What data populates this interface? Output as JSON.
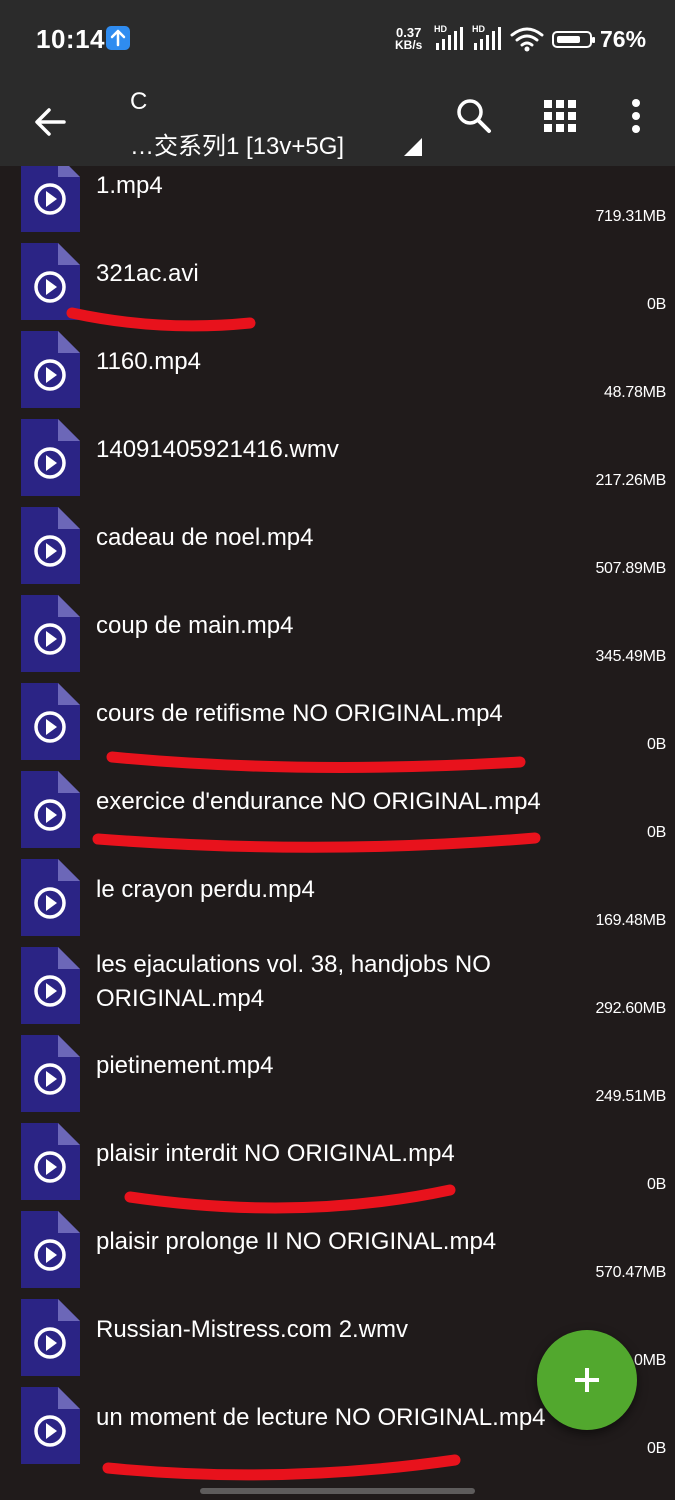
{
  "status_bar": {
    "time": "10:14",
    "net_speed_value": "0.37",
    "net_speed_unit": "KB/s",
    "hd1": "HD",
    "hd2": "HD",
    "battery_percent": "76%",
    "battery_level": 0.76
  },
  "app_bar": {
    "drive": "C",
    "path": "…交系列1 [13v+5G]"
  },
  "files": [
    {
      "name": "1.mp4",
      "size": "719.31MB"
    },
    {
      "name": "321ac.avi",
      "size": "0B"
    },
    {
      "name": "1160.mp4",
      "size": "48.78MB"
    },
    {
      "name": "14091405921416.wmv",
      "size": "217.26MB"
    },
    {
      "name": "cadeau de noel.mp4",
      "size": "507.89MB"
    },
    {
      "name": "coup de main.mp4",
      "size": "345.49MB"
    },
    {
      "name": "cours de retifisme NO ORIGINAL.mp4",
      "size": "0B"
    },
    {
      "name": "exercice d'endurance NO ORIGINAL.mp4",
      "size": "0B"
    },
    {
      "name": "le crayon perdu.mp4",
      "size": "169.48MB"
    },
    {
      "name": "les ejaculations vol. 38, handjobs NO ORIGINAL.mp4",
      "size": "292.60MB"
    },
    {
      "name": "pietinement.mp4",
      "size": "249.51MB"
    },
    {
      "name": "plaisir interdit NO ORIGINAL.mp4",
      "size": "0B"
    },
    {
      "name": "plaisir prolonge II NO ORIGINAL.mp4",
      "size": "570.47MB"
    },
    {
      "name": "Russian-Mistress.com 2.wmv",
      "size": "0MB"
    },
    {
      "name": "un moment de lecture NO ORIGINAL.mp4",
      "size": "0B"
    }
  ],
  "fab": {
    "icon": "plus-icon"
  },
  "colors": {
    "background": "#201b1b",
    "app_bar": "#2b2b2b",
    "file_icon": "#2b2485",
    "file_icon_fold": "#6c67b8",
    "fab": "#52a82e",
    "annotation_mark": "#e8121c"
  }
}
